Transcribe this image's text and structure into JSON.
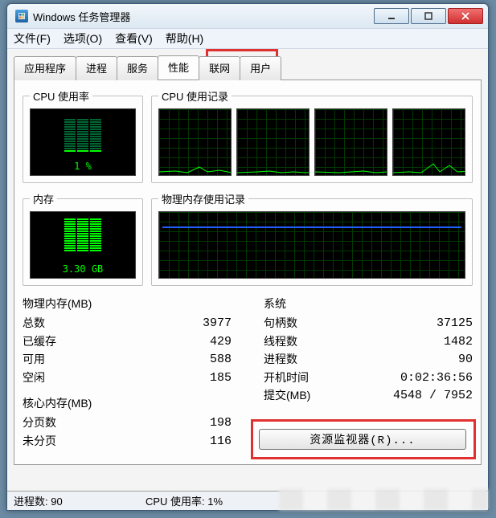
{
  "window": {
    "title": "Windows 任务管理器"
  },
  "menu": {
    "file": "文件(F)",
    "options": "选项(O)",
    "view": "查看(V)",
    "help": "帮助(H)"
  },
  "tabs": {
    "applications": "应用程序",
    "processes": "进程",
    "services": "服务",
    "performance": "性能",
    "networking": "联网",
    "users": "用户"
  },
  "groups": {
    "cpu_usage": "CPU 使用率",
    "cpu_history": "CPU 使用记录",
    "memory": "内存",
    "phys_mem_history": "物理内存使用记录"
  },
  "cpu": {
    "percent_text": "1 %"
  },
  "memory": {
    "value_text": "3.30 GB"
  },
  "phys_mem": {
    "title": "物理内存(MB)",
    "total_label": "总数",
    "total": "3977",
    "cached_label": "已缓存",
    "cached": "429",
    "avail_label": "可用",
    "avail": "588",
    "free_label": "空闲",
    "free": "185"
  },
  "kernel_mem": {
    "title": "核心内存(MB)",
    "paged_label": "分页数",
    "paged": "198",
    "nonpaged_label": "未分页",
    "nonpaged": "116"
  },
  "system": {
    "title": "系统",
    "handles_label": "句柄数",
    "handles": "37125",
    "threads_label": "线程数",
    "threads": "1482",
    "processes_label": "进程数",
    "processes": "90",
    "uptime_label": "开机时间",
    "uptime": "0:02:36:56",
    "commit_label": "提交(MB)",
    "commit": "4548 / 7952"
  },
  "buttons": {
    "resource_monitor": "资源监视器(R)..."
  },
  "status": {
    "processes": "进程数: 90",
    "cpu": "CPU 使用率: 1%"
  }
}
